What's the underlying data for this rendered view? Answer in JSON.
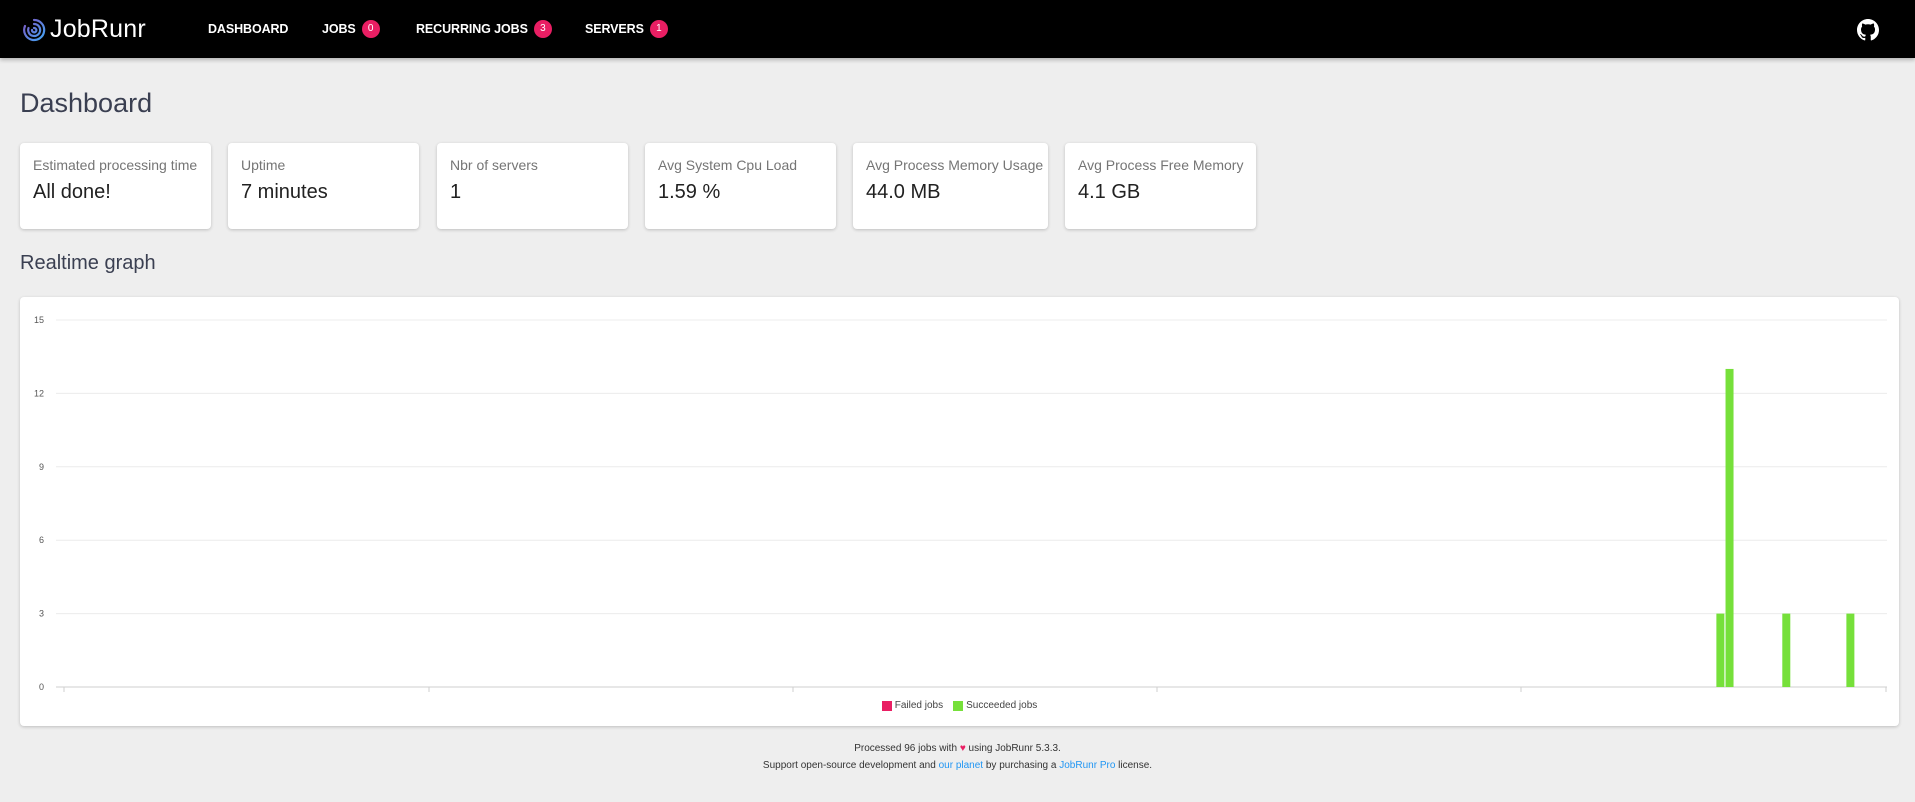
{
  "app": {
    "name": "JobRunr"
  },
  "nav": {
    "items": [
      {
        "label": "DASHBOARD"
      },
      {
        "label": "JOBS",
        "badge": "0"
      },
      {
        "label": "RECURRING JOBS",
        "badge": "3"
      },
      {
        "label": "SERVERS",
        "badge": "1"
      }
    ]
  },
  "page": {
    "title": "Dashboard",
    "graph_title": "Realtime graph"
  },
  "stats": [
    {
      "label": "Estimated processing time",
      "value": "All done!"
    },
    {
      "label": "Uptime",
      "value": "7 minutes"
    },
    {
      "label": "Nbr of servers",
      "value": "1"
    },
    {
      "label": "Avg System Cpu Load",
      "value": "1.59 %"
    },
    {
      "label": "Avg Process Memory Usage",
      "value": "44.0 MB"
    },
    {
      "label": "Avg Process Free Memory",
      "value": "4.1 GB"
    }
  ],
  "colors": {
    "failed": "#e91e63",
    "succeeded": "#76e03a",
    "accent": "#2196f3",
    "badge": "#e91e63"
  },
  "chart_data": {
    "type": "bar",
    "title": "Realtime graph",
    "ylim": [
      0,
      15
    ],
    "yticks": [
      "0",
      "3",
      "6",
      "9",
      "12",
      "15"
    ],
    "x_range": [
      0,
      100
    ],
    "legend_position": "bottom",
    "series": [
      {
        "name": "Failed jobs",
        "color": "#e91e63",
        "points": []
      },
      {
        "name": "Succeeded jobs",
        "color": "#76e03a",
        "points": [
          {
            "x": 90.9,
            "y": 3
          },
          {
            "x": 91.4,
            "y": 13
          },
          {
            "x": 94.5,
            "y": 3
          },
          {
            "x": 98.0,
            "y": 3
          }
        ]
      }
    ],
    "grid": true
  },
  "footer": {
    "processed_prefix": "Processed 96 jobs with",
    "heart": "♥",
    "processed_suffix": "using JobRunr 5.3.3.",
    "support_prefix": "Support open-source development and",
    "planet_link": "our planet",
    "support_mid": "by purchasing a",
    "pro_link": "JobRunr Pro",
    "support_suffix": "license."
  }
}
